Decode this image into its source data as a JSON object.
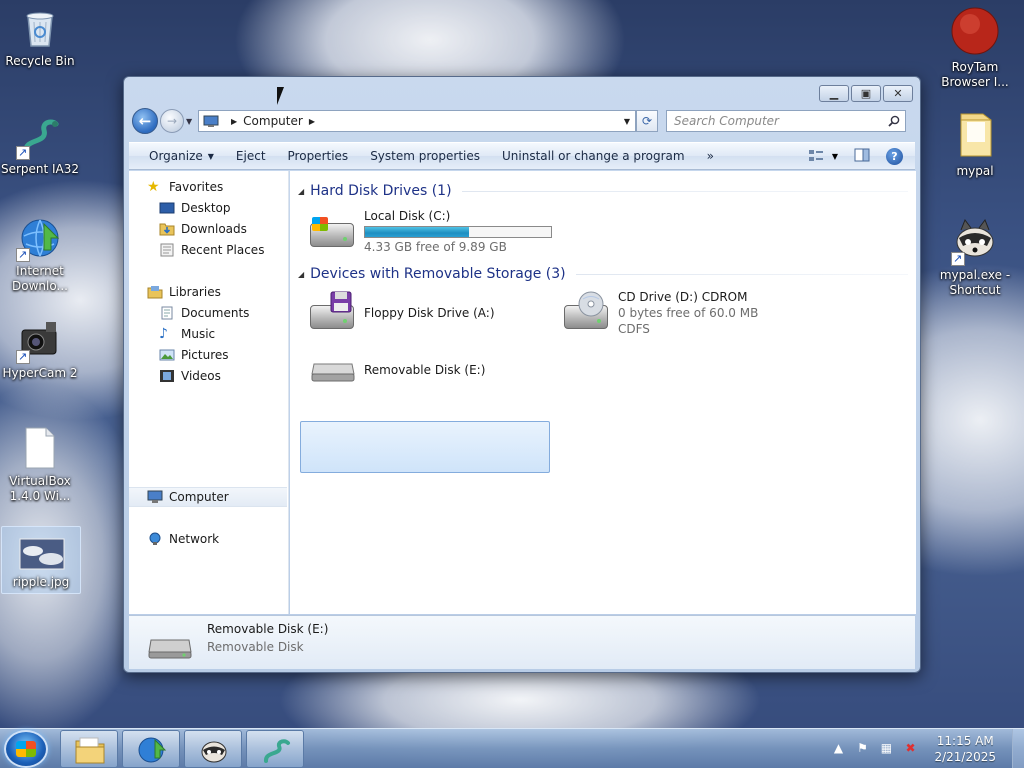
{
  "desktop": {
    "icons_left": [
      {
        "label": "Recycle Bin"
      },
      {
        "label": "Serpent IA32"
      },
      {
        "label": "Internet Downlo..."
      },
      {
        "label": "HyperCam 2"
      },
      {
        "label": "VirtualBox 1.4.0 Wi..."
      },
      {
        "label": "ripple.jpg"
      }
    ],
    "icons_right": [
      {
        "label": "RoyTam Browser I..."
      },
      {
        "label": "mypal"
      },
      {
        "label": "mypal.exe - Shortcut"
      }
    ]
  },
  "window": {
    "address": {
      "location": "Computer"
    },
    "search": {
      "placeholder": "Search Computer"
    },
    "toolbar": {
      "organize": "Organize",
      "eject": "Eject",
      "properties": "Properties",
      "system_properties": "System properties",
      "uninstall": "Uninstall or change a program",
      "more": "»"
    },
    "nav": {
      "favorites": "Favorites",
      "desktop": "Desktop",
      "downloads": "Downloads",
      "recent_places": "Recent Places",
      "libraries": "Libraries",
      "documents": "Documents",
      "music": "Music",
      "pictures": "Pictures",
      "videos": "Videos",
      "computer": "Computer",
      "network": "Network"
    },
    "groups": {
      "hard_disk": {
        "title": "Hard Disk Drives (1)",
        "items": [
          {
            "name": "Local Disk (C:)",
            "free_text": "4.33 GB free of 9.89 GB",
            "used_fraction": 0.56
          }
        ]
      },
      "removable": {
        "title": "Devices with Removable Storage (3)",
        "items": [
          {
            "name": "Floppy Disk Drive (A:)"
          },
          {
            "name": "CD Drive (D:) CDROM",
            "free_text": "0 bytes free of 60.0 MB",
            "fs": "CDFS"
          },
          {
            "name": "Removable Disk (E:)"
          }
        ]
      }
    },
    "details": {
      "name": "Removable Disk (E:)",
      "type": "Removable Disk"
    }
  },
  "taskbar": {
    "clock_time": "11:15 AM",
    "clock_date": "2/21/2025"
  },
  "colors": {
    "group_heading": "#1e3287",
    "selection": "#cfe4fa",
    "disk_bar": "#1f8fc1"
  }
}
